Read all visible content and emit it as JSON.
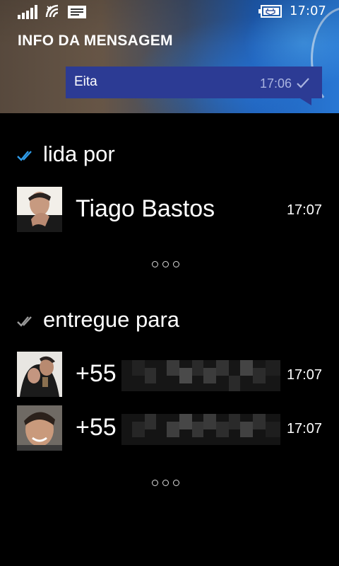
{
  "status_bar": {
    "time": "17:07",
    "icons": [
      "signal-icon",
      "wifi-icon",
      "message-icon",
      "battery-charging-icon"
    ]
  },
  "header": {
    "title": "INFO DA MENSAGEM"
  },
  "message": {
    "text": "Eita",
    "time": "17:06",
    "status_icon": "single-check-icon",
    "bubble_color": "#2c3b94"
  },
  "sections": [
    {
      "label": "lida por",
      "icon": "double-check-blue-icon",
      "icon_color": "#2f9be8",
      "contacts": [
        {
          "name": "Tiago Bastos",
          "time": "17:07"
        }
      ],
      "more_icon": "more-dots-icon"
    },
    {
      "label": "entregue para",
      "icon": "double-check-gray-icon",
      "icon_color": "#9a9a9a",
      "contacts": [
        {
          "name": "+55",
          "time": "17:07"
        },
        {
          "name": "+55",
          "time": "17:07"
        }
      ],
      "more_icon": "more-dots-icon"
    }
  ]
}
